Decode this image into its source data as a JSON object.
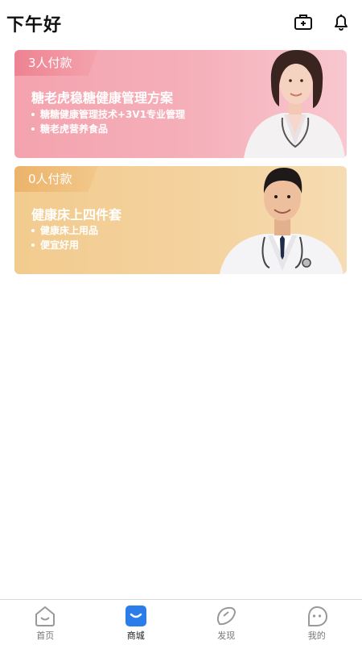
{
  "header": {
    "greeting": "下午好",
    "icons": [
      "medkit-icon",
      "bell-icon"
    ]
  },
  "cards": [
    {
      "tag": "3人付款",
      "title": "糖老虎稳糖健康管理方案",
      "bullets": [
        "糖糖健康管理技术+3V1专业管理",
        "糖老虎营养食品"
      ],
      "color": "#f4a3ae"
    },
    {
      "tag": "0人付款",
      "title": "健康床上四件套",
      "bullets": [
        "健康床上用品",
        "便宜好用"
      ],
      "color": "#f2cb8e"
    }
  ],
  "tabbar": {
    "items": [
      {
        "label": "首页",
        "icon": "home-icon",
        "active": false
      },
      {
        "label": "商城",
        "icon": "mall-icon",
        "active": true
      },
      {
        "label": "发现",
        "icon": "discover-icon",
        "active": false
      },
      {
        "label": "我的",
        "icon": "profile-icon",
        "active": false
      }
    ],
    "active_color": "#2b7de9"
  }
}
